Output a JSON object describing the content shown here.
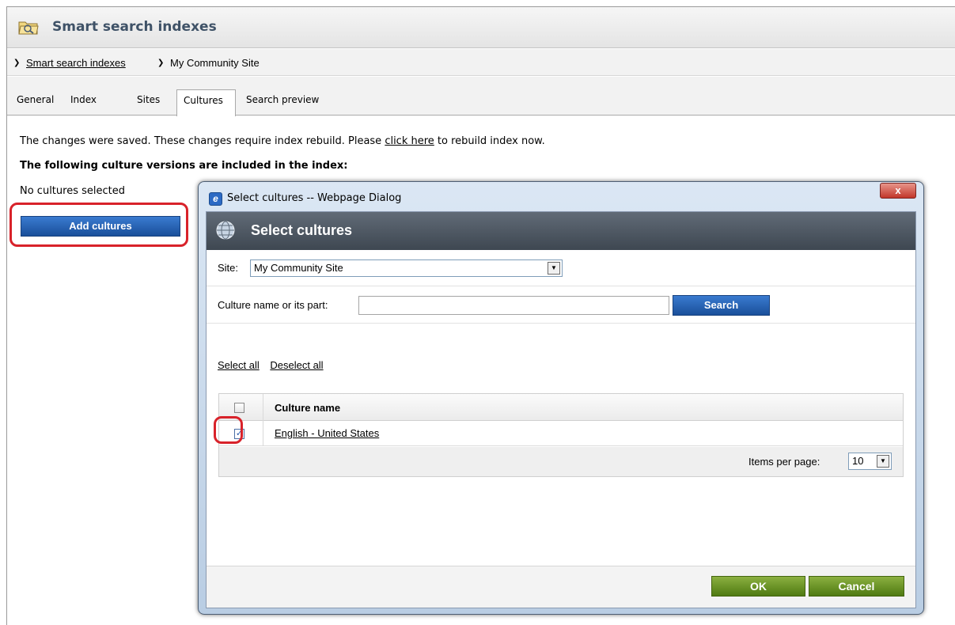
{
  "page": {
    "title": "Smart search indexes",
    "breadcrumb": {
      "link": "Smart search indexes",
      "current": "My Community Site"
    },
    "tabs": [
      "General",
      "Index",
      "Sites",
      "Cultures",
      "Search preview"
    ],
    "active_tab": "Cultures",
    "message": {
      "before": "The changes were saved. These changes require index rebuild. Please ",
      "link": "click here",
      "after": " to rebuild index now."
    },
    "heading": "The following culture versions are included in the index:",
    "no_cultures": "No cultures selected",
    "add_button": "Add cultures"
  },
  "dialog": {
    "window_title": "Select cultures -- Webpage Dialog",
    "close_glyph": "x",
    "header": "Select cultures",
    "site_label": "Site:",
    "site_value": "My Community Site",
    "culture_label": "Culture name or its part:",
    "culture_value": "",
    "search_button": "Search",
    "select_all": "Select all",
    "deselect_all": "Deselect all",
    "grid": {
      "column_header": "Culture name",
      "rows": [
        {
          "name": "English - United States",
          "checked": true
        }
      ],
      "items_per_page_label": "Items per page:",
      "items_per_page_value": "10"
    },
    "ok_button": "OK",
    "cancel_button": "Cancel"
  },
  "colors": {
    "highlight": "#d8222a",
    "primary_button": "#1a4f9a",
    "ok_button": "#4f7a12"
  },
  "icons": [
    "folder-search-icon",
    "breadcrumb-arrow-icon",
    "ie-icon",
    "close-icon",
    "globe-icon",
    "dropdown-arrow-icon",
    "checkbox-icon"
  ]
}
